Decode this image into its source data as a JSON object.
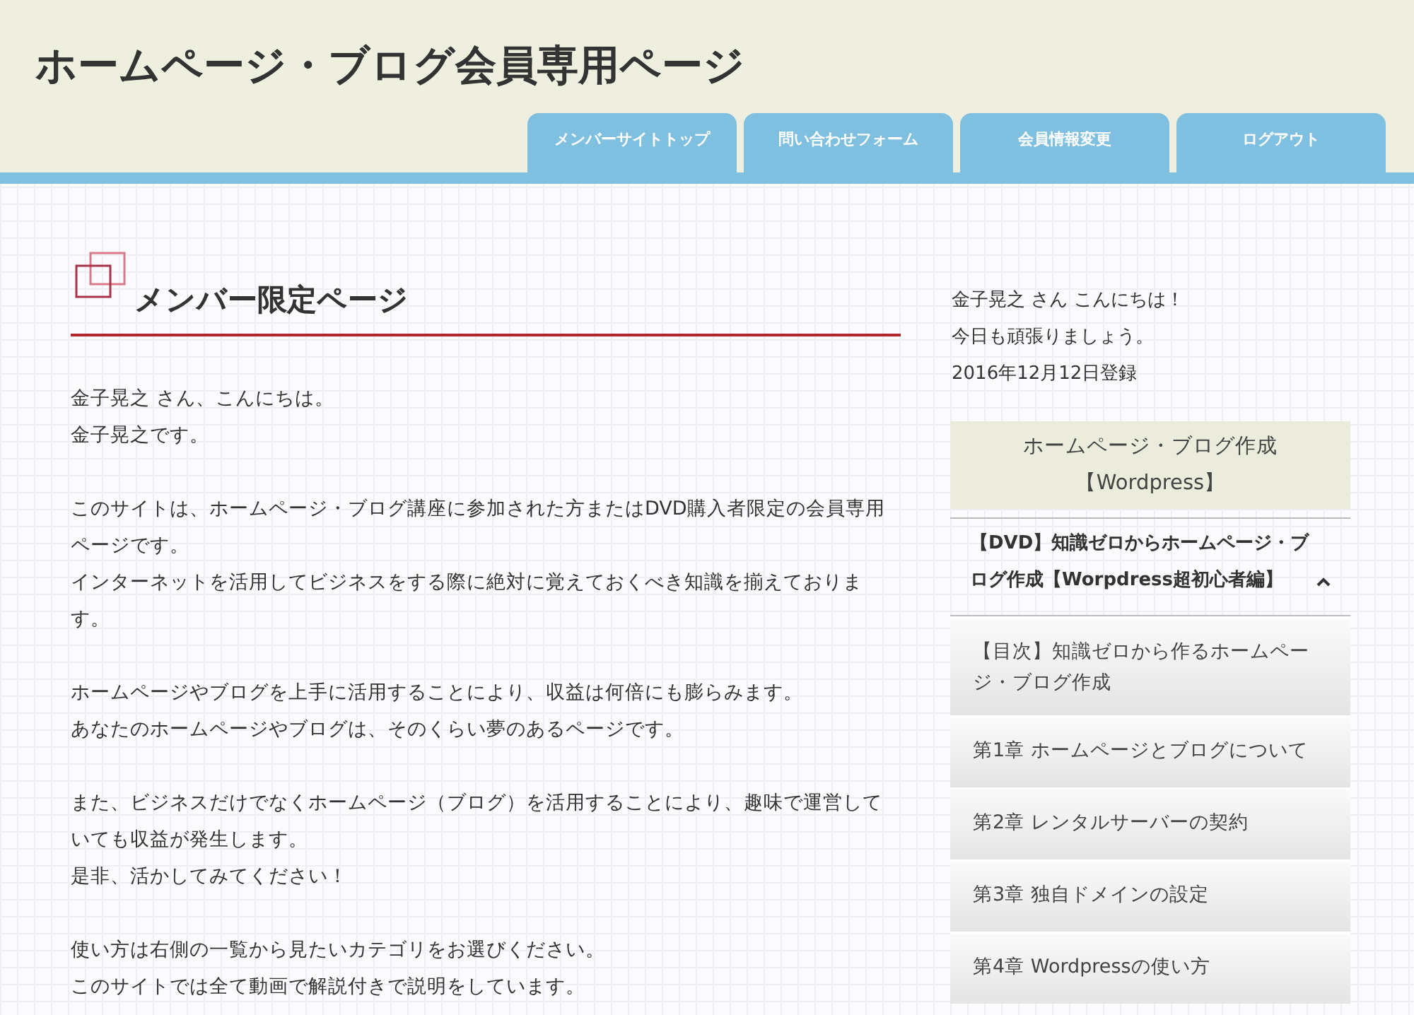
{
  "site_title": "ホームページ・ブログ会員専用ページ",
  "nav_tabs": [
    {
      "label": "メンバーサイトトップ"
    },
    {
      "label": "問い合わせフォーム"
    },
    {
      "label": "会員情報変更"
    },
    {
      "label": "ログアウト"
    }
  ],
  "main": {
    "heading": "メンバー限定ページ",
    "paragraphs": [
      [
        "金子晃之 さん、こんにちは。",
        "金子晃之です。"
      ],
      [
        "このサイトは、ホームページ・ブログ講座に参加された方またはDVD購入者限定の会員専用ページです。",
        "インターネットを活用してビジネスをする際に絶対に覚えておくべき知識を揃えております。"
      ],
      [
        "ホームページやブログを上手に活用することにより、収益は何倍にも膨らみます。",
        "あなたのホームページやブログは、そのくらい夢のあるページです。"
      ],
      [
        "また、ビジネスだけでなくホームページ（ブログ）を活用することにより、趣味で運営していても収益が発生します。",
        "是非、活かしてみてください！"
      ],
      [
        "使い方は右側の一覧から見たいカテゴリをお選びください。",
        "このサイトでは全て動画で解説付きで説明をしています。"
      ]
    ]
  },
  "sidebar": {
    "greeting": [
      "金子晃之 さん こんにちは！",
      "今日も頑張りましょう。",
      "2016年12月12日登録"
    ],
    "category": "ホームページ・ブログ作成【Wordpress】",
    "accordion": {
      "title": "【DVD】知識ゼロからホームページ・ブログ作成【Worpdress超初心者編】",
      "expanded": true,
      "items": [
        {
          "label": "【目次】知識ゼロから作るホームページ・ブログ作成"
        },
        {
          "label": "第1章 ホームページとブログについて"
        },
        {
          "label": "第2章 レンタルサーバーの契約"
        },
        {
          "label": "第3章 独自ドメインの設定"
        },
        {
          "label": "第4章 Wordpressの使い方"
        }
      ]
    }
  }
}
